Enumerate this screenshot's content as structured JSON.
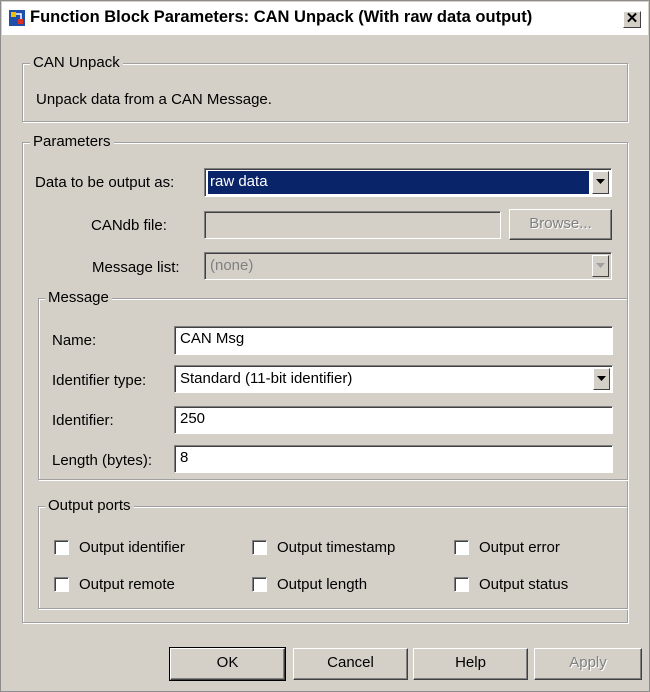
{
  "window": {
    "title": "Function Block Parameters: CAN Unpack (With raw data output)",
    "close_glyph": "✕"
  },
  "description_group": {
    "legend": "CAN Unpack",
    "text": "Unpack data from a CAN Message."
  },
  "parameters": {
    "legend": "Parameters",
    "output_as_label": "Data to be output as:",
    "output_as_value": "raw data",
    "candb_label": "CANdb file:",
    "candb_value": "",
    "browse_label": "Browse...",
    "message_list_label": "Message list:",
    "message_list_value": "(none)"
  },
  "message": {
    "legend": "Message",
    "name_label": "Name:",
    "name_value": "CAN Msg",
    "id_type_label": "Identifier type:",
    "id_type_value": "Standard (11-bit identifier)",
    "identifier_label": "Identifier:",
    "identifier_value": "250",
    "length_label": "Length (bytes):",
    "length_value": "8"
  },
  "output_ports": {
    "legend": "Output ports",
    "checkboxes": [
      {
        "label": "Output identifier",
        "checked": false
      },
      {
        "label": "Output timestamp",
        "checked": false
      },
      {
        "label": "Output error",
        "checked": false
      },
      {
        "label": "Output remote",
        "checked": false
      },
      {
        "label": "Output length",
        "checked": false
      },
      {
        "label": "Output status",
        "checked": false
      }
    ]
  },
  "buttons": {
    "ok": "OK",
    "cancel": "Cancel",
    "help": "Help",
    "apply": "Apply"
  },
  "icons": {
    "app": "simulink-block-icon",
    "close": "close-icon",
    "dropdown": "chevron-down-icon"
  },
  "colors": {
    "dialog_bg": "#d4d0c8",
    "selection": "#0a246a",
    "field_bg": "#ffffff"
  }
}
